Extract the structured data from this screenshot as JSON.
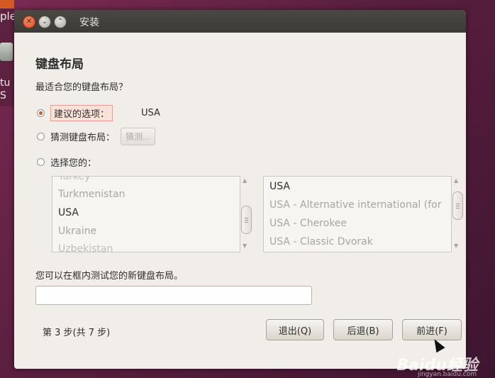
{
  "desktop": {
    "label_top": "ple",
    "label_bottom": "tu S"
  },
  "window": {
    "title": "安装"
  },
  "page": {
    "heading": "键盘布局",
    "question": "最适合您的键盘布局？"
  },
  "options": {
    "suggested_label": "建议的选项：",
    "suggested_value": "USA",
    "guess_label": "猜测键盘布局：",
    "guess_button": "猜测...",
    "choose_label": "选择您的："
  },
  "layouts": {
    "left_items": [
      "Turkey",
      "Turkmenistan",
      "USA",
      "Ukraine",
      "Uzbekistan"
    ],
    "right_items": [
      "USA",
      "USA - Alternative international (for",
      "USA - Cherokee",
      "USA - Classic Dvorak"
    ]
  },
  "test": {
    "label": "您可以在框内测试您的新键盘布局。",
    "value": ""
  },
  "footer": {
    "step_text": "第 3 步(共 7 步)",
    "quit_label": "退出(Q)",
    "back_label": "后退(B)",
    "forward_label": "前进(F)"
  },
  "watermark": {
    "text": "Baidu经验",
    "sub": "jingyan.baidu.com"
  },
  "colors": {
    "accent": "#e2531a",
    "window_bg": "#f1eeea",
    "titlebar": "#3b3a36"
  }
}
